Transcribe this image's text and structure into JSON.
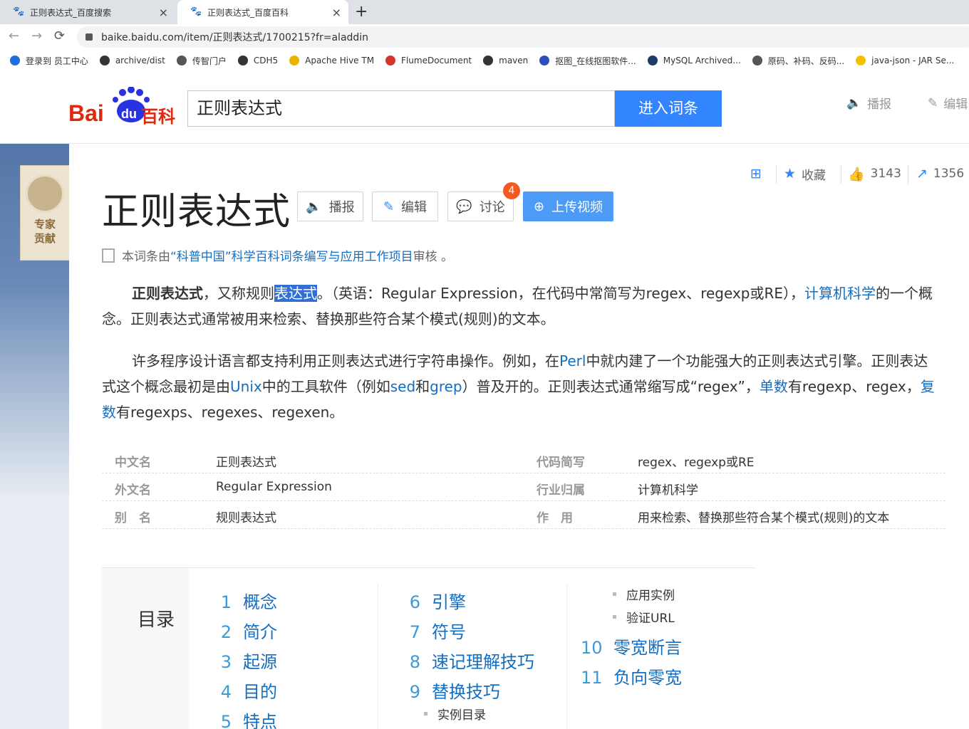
{
  "browser": {
    "tabs": [
      {
        "title": "正则表达式_百度搜索",
        "close": "×"
      },
      {
        "title": "正则表达式_百度百科",
        "close": "×"
      }
    ],
    "new_tab": "+",
    "back": "←",
    "forward": "→",
    "reload": "⟳",
    "url": "baike.baidu.com/item/正则表达式/1700215?fr=aladdin",
    "bookmarks": [
      {
        "label": "登录到 员工中心",
        "color": "#1e6fd9"
      },
      {
        "label": "archive/dist",
        "color": "#333333"
      },
      {
        "label": "传智门户",
        "color": "#555555"
      },
      {
        "label": "CDH5",
        "color": "#333333"
      },
      {
        "label": "Apache Hive TM",
        "color": "#e8b400"
      },
      {
        "label": "FlumeDocument",
        "color": "#d9342b"
      },
      {
        "label": "maven",
        "color": "#333333"
      },
      {
        "label": "抠图_在线抠图软件...",
        "color": "#2b4fbf"
      },
      {
        "label": "MySQL Archived...",
        "color": "#1c3d6b"
      },
      {
        "label": "原码、补码、反码...",
        "color": "#555555"
      },
      {
        "label": "java-json - JAR Se...",
        "color": "#f2c200"
      }
    ]
  },
  "header": {
    "logo_left": "Bai",
    "logo_paw": "du",
    "logo_right": "百科",
    "search_value": "正则表达式",
    "search_button": "进入词条",
    "broadcast": "播报",
    "edit": "编辑"
  },
  "expert": {
    "line1": "专家",
    "line2": "贡献"
  },
  "article": {
    "title": "正则表达式",
    "btn_broadcast": "播报",
    "btn_edit": "编辑",
    "btn_discuss": "讨论",
    "discuss_badge": "4",
    "btn_upload": "上传视频",
    "collect": "收藏",
    "likes": "3143",
    "shares": "1356",
    "audit_prefix": "本词条由",
    "audit_link": "“科普中国”科学百科词条编写与应用工作项目",
    "audit_suffix": " 审核 。",
    "p1": {
      "bold": "正则表达式",
      "a": "，又称规则",
      "selected": "表达式",
      "b": "。（英语：Regular Expression，在代码中常简写为regex、regexp或RE），",
      "link": "计算机科学",
      "c": "的一个概念。正则表达式通常被用来检索、替换那些符合某个模式(规则)的文本。"
    },
    "p2": {
      "a": "许多程序设计语言都支持利用正则表达式进行字符串操作。例如，在",
      "l1": "Perl",
      "b": "中就内建了一个功能强大的正则表达式引擎。正则表达式这个概念最初是由",
      "l2": "Unix",
      "c": "中的工具软件（例如",
      "l3": "sed",
      "d": "和",
      "l4": "grep",
      "e": "）普及开的。正则表达式通常缩写成“regex”，",
      "l5": "单数",
      "f": "有regexp、regex，",
      "l6": "复数",
      "g": "有regexps、regexes、regexen。"
    }
  },
  "infobox": [
    {
      "k1": "中文名",
      "v1": "正则表达式",
      "k2": "代码简写",
      "v2": "regex、regexp或RE"
    },
    {
      "k1": "外文名",
      "v1": "Regular Expression",
      "k2": "行业归属",
      "v2": "计算机科学"
    },
    {
      "k1": "别　名",
      "v1": "规则表达式",
      "k2": "作　用",
      "v2": "用来检索、替换那些符合某个模式(规则)的文本"
    }
  ],
  "catalog": {
    "heading": "目录",
    "items": [
      {
        "n": "1",
        "t": "概念"
      },
      {
        "n": "2",
        "t": "简介"
      },
      {
        "n": "3",
        "t": "起源"
      },
      {
        "n": "4",
        "t": "目的"
      },
      {
        "n": "5",
        "t": "特点"
      },
      {
        "n": "6",
        "t": "引擎"
      },
      {
        "n": "7",
        "t": "符号"
      },
      {
        "n": "8",
        "t": "速记理解技巧"
      },
      {
        "n": "9",
        "t": "替换技巧"
      },
      {
        "n": "10",
        "t": "零宽断言"
      },
      {
        "n": "11",
        "t": "负向零宽"
      }
    ],
    "subs": [
      "实例目录",
      "应用实例",
      "验证URL"
    ]
  }
}
